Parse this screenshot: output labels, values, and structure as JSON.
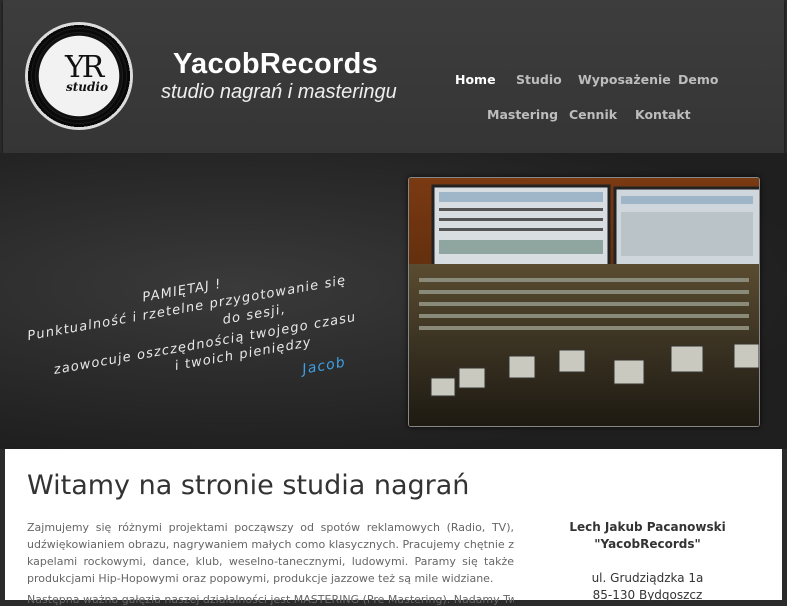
{
  "header": {
    "logo_monogram": "YR",
    "logo_subtext": "studio",
    "brand_title": "YacobRecords",
    "brand_tagline": "studio nagrań i masteringu"
  },
  "nav": {
    "items": [
      {
        "label": "Home",
        "active": true
      },
      {
        "label": "Studio",
        "active": false
      },
      {
        "label": "Wyposażenie",
        "active": false
      },
      {
        "label": "Demo",
        "active": false
      },
      {
        "label": "Mastering",
        "active": false
      },
      {
        "label": "Cennik",
        "active": false
      },
      {
        "label": "Kontakt",
        "active": false
      }
    ]
  },
  "hero": {
    "quote_lines": [
      "PAMIĘTAJ !",
      "Punktualność i rzetelne przygotowanie się",
      "do sesji,",
      "zaowocuje oszczędnością twojego czasu",
      "i twoich pieniędzy"
    ],
    "quote_signature": "Jacob"
  },
  "main": {
    "heading": "Witamy na stronie studia nagrań",
    "intro": "Zajmujemy się różnymi projektami począwszy od spotów reklamowych (Radio, TV), udźwiękowianiem obrazu, nagrywaniem małych como klasycznych. Pracujemy chętnie z kapelami rockowymi, dance, klub, weselno-tanecznymi, ludowymi. Paramy się także produkcjami Hip-Hopowymi oraz popowymi, produkcje jazzowe też są mile widziane.",
    "intro_cut": "Następna ważna gałęzia naszej działalności jest MASTERING (Pre Mastering). Nadamy Twoi..."
  },
  "contact": {
    "name": "Lech Jakub Pacanowski",
    "company": "\"YacobRecords\"",
    "street": "ul. Grudziądzka 1a",
    "city": "85-130 Bydgoszcz"
  }
}
